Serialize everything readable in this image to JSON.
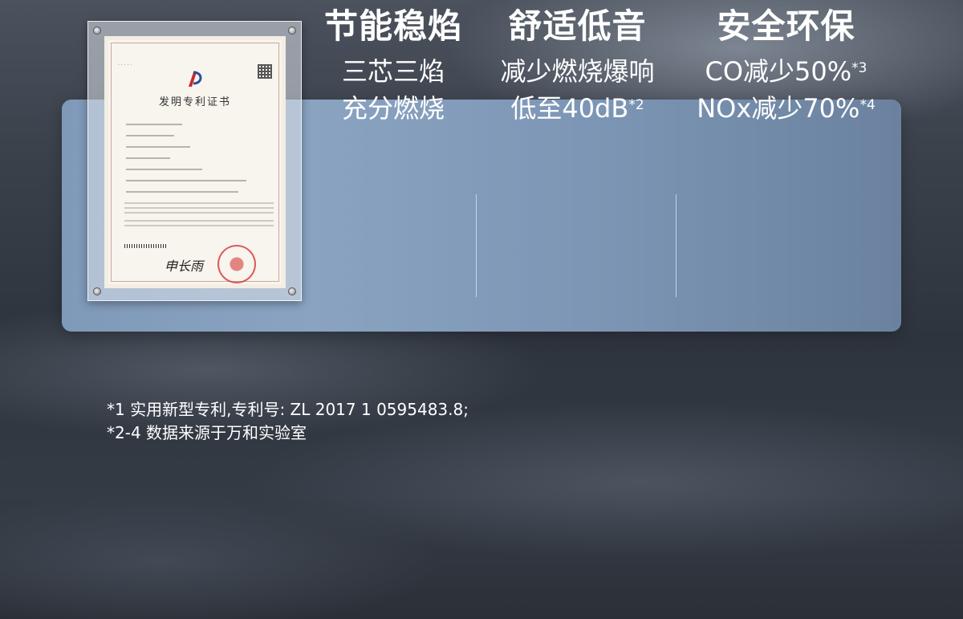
{
  "features": [
    {
      "title": "节能稳焰",
      "lines": [
        {
          "text": "三芯三焰",
          "sup": ""
        },
        {
          "text": "充分燃烧",
          "sup": ""
        }
      ]
    },
    {
      "title": "舒适低音",
      "lines": [
        {
          "text": "减少燃烧爆响",
          "sup": ""
        },
        {
          "text": "低至40dB",
          "sup": "*2"
        }
      ]
    },
    {
      "title": "安全环保",
      "lines": [
        {
          "text": "CO减少50%",
          "sup": "*3"
        },
        {
          "text": "NOx减少70%",
          "sup": "*4"
        }
      ]
    }
  ],
  "footnotes": [
    "*1 实用新型专利,专利号: ZL 2017 1 0595483.8;",
    "*2-4 数据来源于万和实验室"
  ],
  "certificate": {
    "title": "发明专利证书",
    "signature": "申长雨"
  },
  "colors": {
    "banner": "#8aa3c1",
    "text": "#ffffff",
    "seal": "#d02828"
  }
}
